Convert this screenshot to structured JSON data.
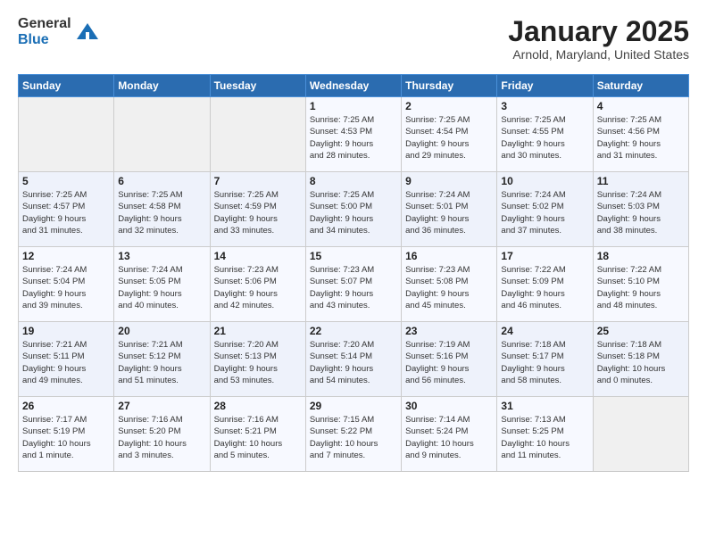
{
  "header": {
    "logo_general": "General",
    "logo_blue": "Blue",
    "month_title": "January 2025",
    "location": "Arnold, Maryland, United States"
  },
  "days_of_week": [
    "Sunday",
    "Monday",
    "Tuesday",
    "Wednesday",
    "Thursday",
    "Friday",
    "Saturday"
  ],
  "weeks": [
    [
      {
        "num": "",
        "info": ""
      },
      {
        "num": "",
        "info": ""
      },
      {
        "num": "",
        "info": ""
      },
      {
        "num": "1",
        "info": "Sunrise: 7:25 AM\nSunset: 4:53 PM\nDaylight: 9 hours\nand 28 minutes."
      },
      {
        "num": "2",
        "info": "Sunrise: 7:25 AM\nSunset: 4:54 PM\nDaylight: 9 hours\nand 29 minutes."
      },
      {
        "num": "3",
        "info": "Sunrise: 7:25 AM\nSunset: 4:55 PM\nDaylight: 9 hours\nand 30 minutes."
      },
      {
        "num": "4",
        "info": "Sunrise: 7:25 AM\nSunset: 4:56 PM\nDaylight: 9 hours\nand 31 minutes."
      }
    ],
    [
      {
        "num": "5",
        "info": "Sunrise: 7:25 AM\nSunset: 4:57 PM\nDaylight: 9 hours\nand 31 minutes."
      },
      {
        "num": "6",
        "info": "Sunrise: 7:25 AM\nSunset: 4:58 PM\nDaylight: 9 hours\nand 32 minutes."
      },
      {
        "num": "7",
        "info": "Sunrise: 7:25 AM\nSunset: 4:59 PM\nDaylight: 9 hours\nand 33 minutes."
      },
      {
        "num": "8",
        "info": "Sunrise: 7:25 AM\nSunset: 5:00 PM\nDaylight: 9 hours\nand 34 minutes."
      },
      {
        "num": "9",
        "info": "Sunrise: 7:24 AM\nSunset: 5:01 PM\nDaylight: 9 hours\nand 36 minutes."
      },
      {
        "num": "10",
        "info": "Sunrise: 7:24 AM\nSunset: 5:02 PM\nDaylight: 9 hours\nand 37 minutes."
      },
      {
        "num": "11",
        "info": "Sunrise: 7:24 AM\nSunset: 5:03 PM\nDaylight: 9 hours\nand 38 minutes."
      }
    ],
    [
      {
        "num": "12",
        "info": "Sunrise: 7:24 AM\nSunset: 5:04 PM\nDaylight: 9 hours\nand 39 minutes."
      },
      {
        "num": "13",
        "info": "Sunrise: 7:24 AM\nSunset: 5:05 PM\nDaylight: 9 hours\nand 40 minutes."
      },
      {
        "num": "14",
        "info": "Sunrise: 7:23 AM\nSunset: 5:06 PM\nDaylight: 9 hours\nand 42 minutes."
      },
      {
        "num": "15",
        "info": "Sunrise: 7:23 AM\nSunset: 5:07 PM\nDaylight: 9 hours\nand 43 minutes."
      },
      {
        "num": "16",
        "info": "Sunrise: 7:23 AM\nSunset: 5:08 PM\nDaylight: 9 hours\nand 45 minutes."
      },
      {
        "num": "17",
        "info": "Sunrise: 7:22 AM\nSunset: 5:09 PM\nDaylight: 9 hours\nand 46 minutes."
      },
      {
        "num": "18",
        "info": "Sunrise: 7:22 AM\nSunset: 5:10 PM\nDaylight: 9 hours\nand 48 minutes."
      }
    ],
    [
      {
        "num": "19",
        "info": "Sunrise: 7:21 AM\nSunset: 5:11 PM\nDaylight: 9 hours\nand 49 minutes."
      },
      {
        "num": "20",
        "info": "Sunrise: 7:21 AM\nSunset: 5:12 PM\nDaylight: 9 hours\nand 51 minutes."
      },
      {
        "num": "21",
        "info": "Sunrise: 7:20 AM\nSunset: 5:13 PM\nDaylight: 9 hours\nand 53 minutes."
      },
      {
        "num": "22",
        "info": "Sunrise: 7:20 AM\nSunset: 5:14 PM\nDaylight: 9 hours\nand 54 minutes."
      },
      {
        "num": "23",
        "info": "Sunrise: 7:19 AM\nSunset: 5:16 PM\nDaylight: 9 hours\nand 56 minutes."
      },
      {
        "num": "24",
        "info": "Sunrise: 7:18 AM\nSunset: 5:17 PM\nDaylight: 9 hours\nand 58 minutes."
      },
      {
        "num": "25",
        "info": "Sunrise: 7:18 AM\nSunset: 5:18 PM\nDaylight: 10 hours\nand 0 minutes."
      }
    ],
    [
      {
        "num": "26",
        "info": "Sunrise: 7:17 AM\nSunset: 5:19 PM\nDaylight: 10 hours\nand 1 minute."
      },
      {
        "num": "27",
        "info": "Sunrise: 7:16 AM\nSunset: 5:20 PM\nDaylight: 10 hours\nand 3 minutes."
      },
      {
        "num": "28",
        "info": "Sunrise: 7:16 AM\nSunset: 5:21 PM\nDaylight: 10 hours\nand 5 minutes."
      },
      {
        "num": "29",
        "info": "Sunrise: 7:15 AM\nSunset: 5:22 PM\nDaylight: 10 hours\nand 7 minutes."
      },
      {
        "num": "30",
        "info": "Sunrise: 7:14 AM\nSunset: 5:24 PM\nDaylight: 10 hours\nand 9 minutes."
      },
      {
        "num": "31",
        "info": "Sunrise: 7:13 AM\nSunset: 5:25 PM\nDaylight: 10 hours\nand 11 minutes."
      },
      {
        "num": "",
        "info": ""
      }
    ]
  ]
}
